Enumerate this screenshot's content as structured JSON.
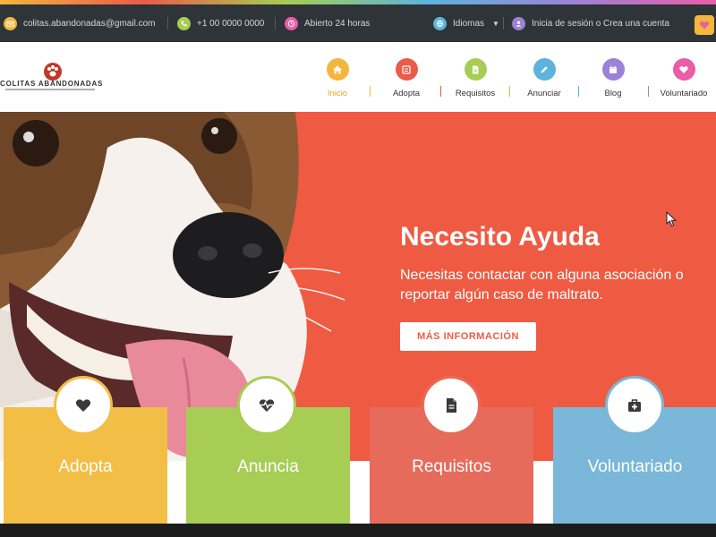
{
  "topbar": {
    "email": "colitas.abandonadas@gmail.com",
    "phone": "+1 00 0000 0000",
    "hours": "Abierto 24 horas",
    "language": "Idiomas",
    "account": "Inicia de sesión o Crea una cuenta",
    "icons": [
      "mail-icon",
      "phone-icon",
      "clock-icon",
      "globe-icon",
      "user-icon",
      "heart-icon"
    ]
  },
  "brand": {
    "name": "COLITAS ABANDONADAS"
  },
  "nav": {
    "items": [
      {
        "label": "Inicio",
        "icon": "home-icon",
        "color": "#f4b63d",
        "active": true
      },
      {
        "label": "Adopta",
        "icon": "list-icon",
        "color": "#ea5b4a"
      },
      {
        "label": "Requisitos",
        "icon": "document-icon",
        "color": "#a7cd54"
      },
      {
        "label": "Anunciar",
        "icon": "edit-icon",
        "color": "#5cb3db"
      },
      {
        "label": "Blog",
        "icon": "calendar-icon",
        "color": "#9c82d6"
      },
      {
        "label": "Voluntariado",
        "icon": "heart-icon",
        "color": "#e95ea6"
      }
    ]
  },
  "hero": {
    "title": "Necesito Ayuda",
    "subtitle": "Necesitas contactar con alguna asociación o reportar algún caso de maltrato.",
    "button": "MÁS INFORMACIÓN",
    "background": "#ef5a42"
  },
  "cards": [
    {
      "label": "Adopta",
      "icon": "heart-icon",
      "color": "#f2be45"
    },
    {
      "label": "Anuncia",
      "icon": "heart-pulse-icon",
      "color": "#a7cd54"
    },
    {
      "label": "Requisitos",
      "icon": "document-icon",
      "color": "#e66b5b"
    },
    {
      "label": "Voluntariado",
      "icon": "first-aid-icon",
      "color": "#7ab7d8"
    }
  ]
}
